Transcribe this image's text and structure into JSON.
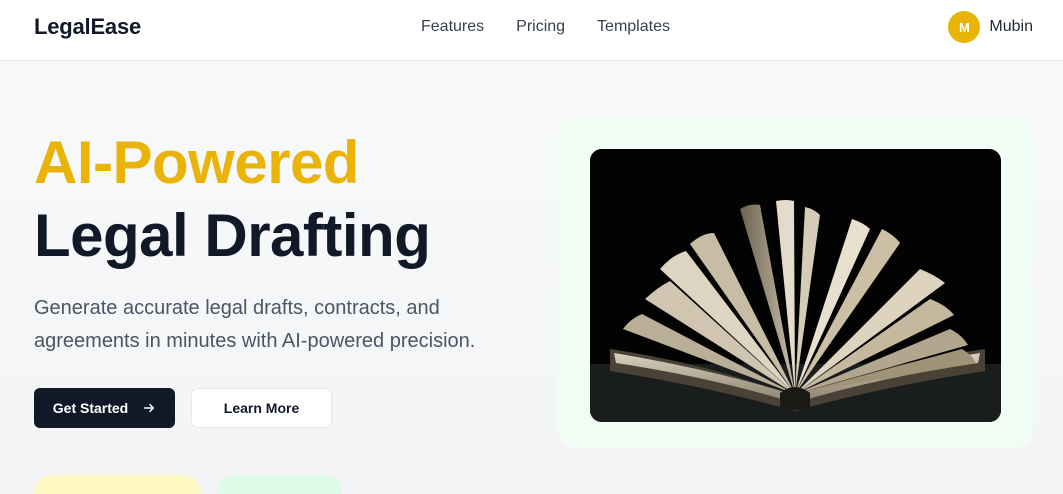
{
  "header": {
    "logo": "LegalEase",
    "nav": [
      {
        "label": "Features"
      },
      {
        "label": "Pricing"
      },
      {
        "label": "Templates"
      }
    ],
    "user": {
      "initial": "M",
      "name": "Mubin"
    }
  },
  "hero": {
    "headline_accent": "AI-Powered",
    "headline_main": "Legal Drafting",
    "subtext": "Generate accurate legal drafts, contracts, and agreements in minutes with AI-powered precision.",
    "primary_button": "Get Started",
    "secondary_button": "Learn More"
  },
  "colors": {
    "accent": "#eab308",
    "dark": "#111827",
    "card_bg": "#f0fdf4"
  }
}
